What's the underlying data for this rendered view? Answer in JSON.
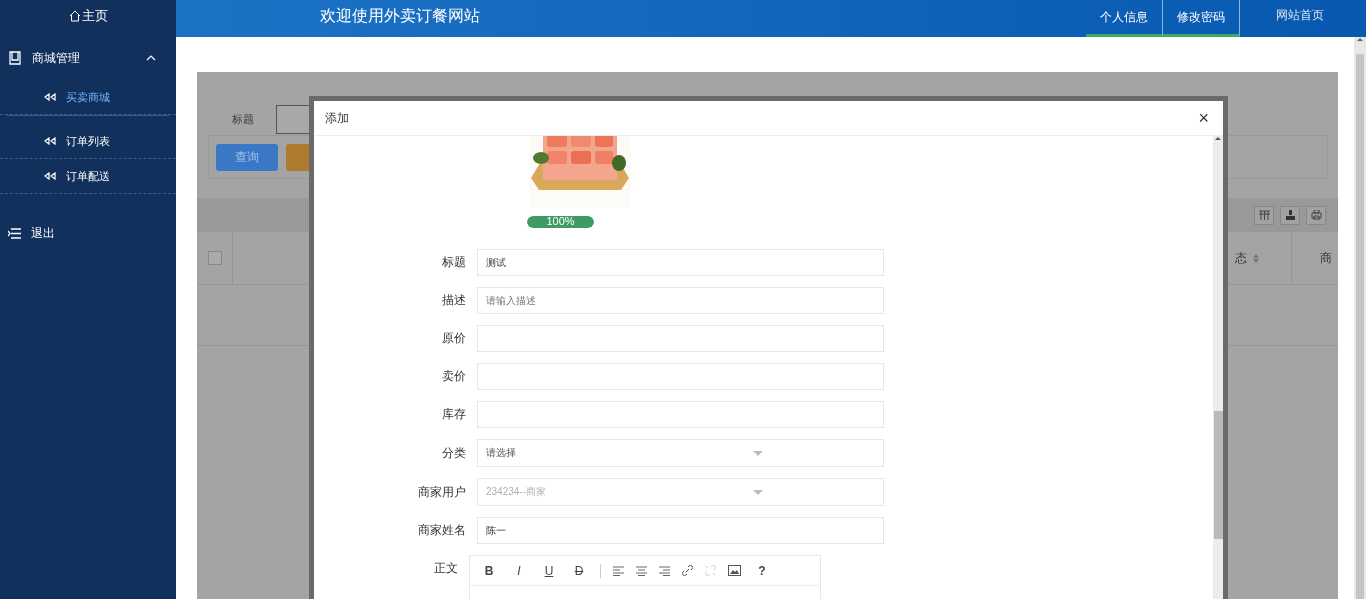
{
  "sidebar": {
    "home": "主页",
    "groups": [
      {
        "label": "商城管理",
        "expanded": true,
        "children": [
          {
            "label": "买卖商城",
            "selected": true
          },
          {
            "label": "订单列表",
            "selected": false
          },
          {
            "label": "订单配送",
            "selected": false
          }
        ]
      }
    ],
    "logout": "退出"
  },
  "header": {
    "title": "欢迎使用外卖订餐网站",
    "nav": [
      {
        "label": "个人信息",
        "selected": true
      },
      {
        "label": "修改密码",
        "selected": true
      },
      {
        "label": "网站首页",
        "selected": false
      }
    ]
  },
  "background": {
    "search_label": "标题",
    "buttons": [
      {
        "kind": "primary",
        "label": "查询"
      },
      {
        "kind": "warning"
      }
    ],
    "table": {
      "checked": false,
      "columns": [
        {
          "label": "态",
          "sortable": true
        },
        {
          "label": "商",
          "sortable": false
        }
      ]
    }
  },
  "modal": {
    "title": "添加",
    "close": "×",
    "upload": {
      "kind": "picture",
      "progress": {
        "level": 1,
        "label": "100%"
      }
    },
    "fields": [
      {
        "label": "标题",
        "kind": "text",
        "value": "测试"
      },
      {
        "label": "描述",
        "kind": "text",
        "placeholder": "请输入描述"
      },
      {
        "label": "原价",
        "kind": "text"
      },
      {
        "label": "卖价",
        "kind": "text"
      },
      {
        "label": "库存",
        "kind": "text"
      },
      {
        "label": "分类",
        "kind": "select",
        "value": "请选择",
        "disabled": false
      },
      {
        "label": "商家用户",
        "kind": "select",
        "value": "234234--商家",
        "disabled": true
      },
      {
        "label": "商家姓名",
        "kind": "text",
        "value": "陈一"
      }
    ],
    "editor": {
      "label": "正文",
      "glyph_buttons": [
        "B",
        "I",
        "U",
        "D"
      ],
      "help": "?"
    }
  }
}
